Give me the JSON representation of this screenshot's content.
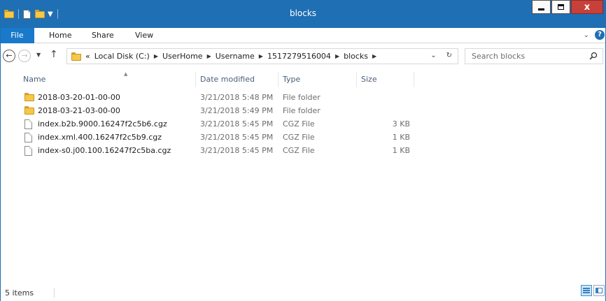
{
  "window": {
    "title": "blocks",
    "controls": {
      "minimize": "minimize",
      "maximize": "maximize",
      "close": "x"
    }
  },
  "ribbon": {
    "tabs": [
      "File",
      "Home",
      "Share",
      "View"
    ],
    "expand_icon": "chevron-down-icon",
    "help": "?"
  },
  "nav": {
    "back_icon": "back-arrow-icon",
    "forward_icon": "forward-arrow-icon",
    "up_icon": "up-arrow-icon",
    "breadcrumb_overflow": "«",
    "breadcrumb": [
      "Local Disk (C:)",
      "UserHome",
      "Username",
      "1517279516004",
      "blocks"
    ],
    "search_placeholder": "Search blocks"
  },
  "list": {
    "columns": [
      "Name",
      "Date modified",
      "Type",
      "Size"
    ],
    "sorted_by": "Name",
    "items": [
      {
        "name": "2018-03-20-01-00-00",
        "date": "3/21/2018 5:48 PM",
        "type": "File folder",
        "size": "",
        "icon": "folder-icon"
      },
      {
        "name": "2018-03-21-03-00-00",
        "date": "3/21/2018 5:49 PM",
        "type": "File folder",
        "size": "",
        "icon": "folder-icon"
      },
      {
        "name": "index.b2b.9000.16247f2c5b6.cgz",
        "date": "3/21/2018 5:45 PM",
        "type": "CGZ File",
        "size": "3 KB",
        "icon": "file-icon"
      },
      {
        "name": "index.xml.400.16247f2c5b9.cgz",
        "date": "3/21/2018 5:45 PM",
        "type": "CGZ File",
        "size": "1 KB",
        "icon": "file-icon"
      },
      {
        "name": "index-s0.j00.100.16247f2c5ba.cgz",
        "date": "3/21/2018 5:45 PM",
        "type": "CGZ File",
        "size": "1 KB",
        "icon": "file-icon"
      }
    ]
  },
  "status": {
    "item_count": "5 items",
    "view": "details"
  },
  "colors": {
    "titlebar": "#1f6fb4",
    "file_tab": "#1979ca",
    "close_button": "#c7413a",
    "folder": "#f5c848"
  }
}
